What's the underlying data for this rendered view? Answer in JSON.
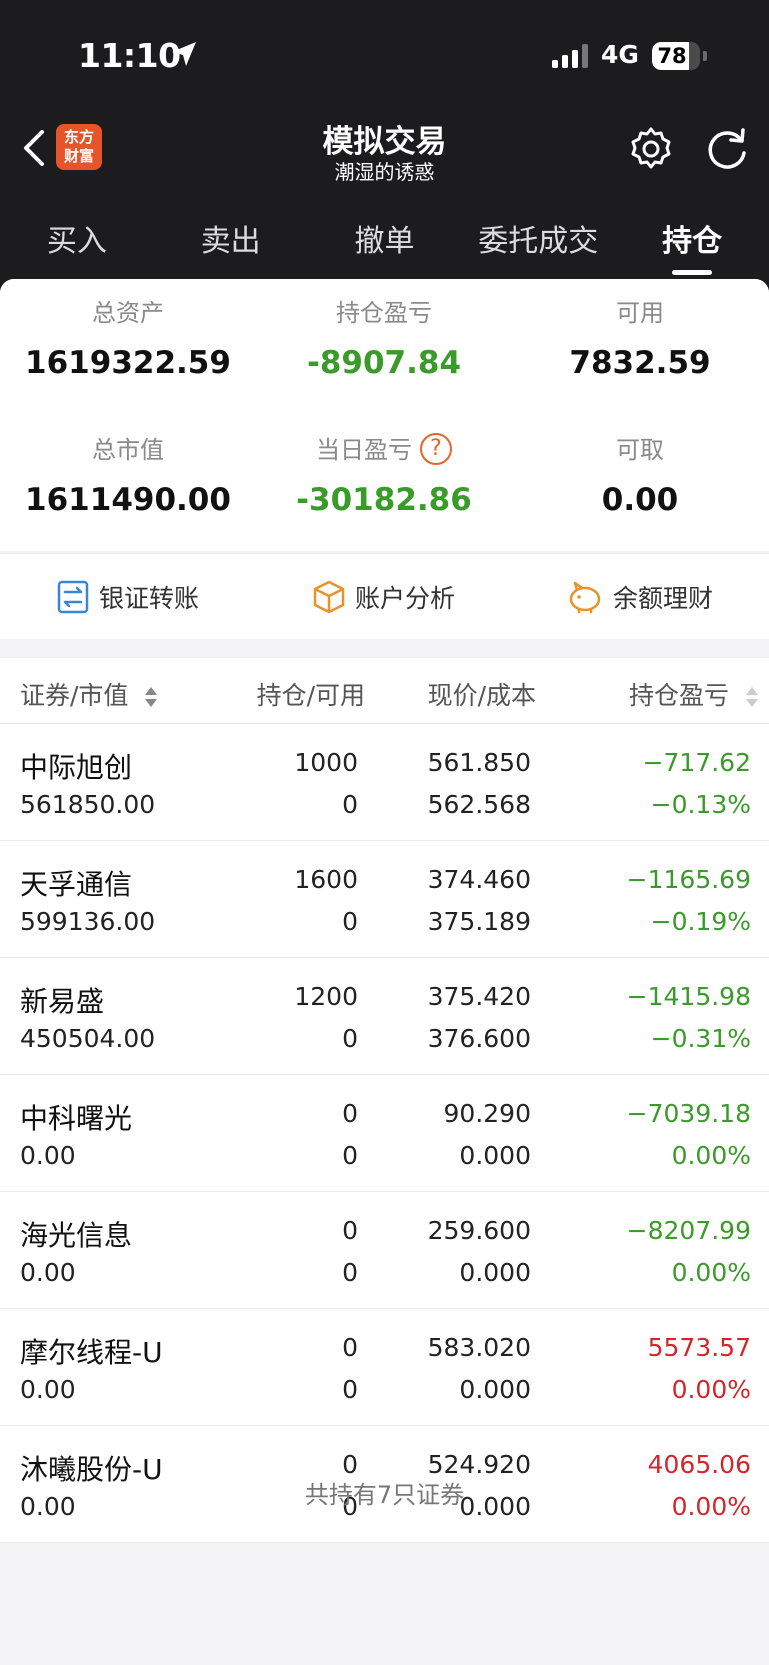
{
  "status": {
    "time": "11:10",
    "network": "4G",
    "battery": "78",
    "battery_level": 0.78
  },
  "nav": {
    "logo_line1": "东方",
    "logo_line2": "财富",
    "title": "模拟交易",
    "subtitle": "潮湿的诱惑"
  },
  "tabs": [
    {
      "label": "买入"
    },
    {
      "label": "卖出"
    },
    {
      "label": "撤单"
    },
    {
      "label": "委托成交"
    },
    {
      "label": "持仓",
      "active": true
    }
  ],
  "summary": {
    "total_assets_label": "总资产",
    "total_assets": "1619322.59",
    "position_pl_label": "持仓盈亏",
    "position_pl": "-8907.84",
    "available_label": "可用",
    "available": "7832.59",
    "market_value_label": "总市值",
    "market_value": "1611490.00",
    "daily_pl_label": "当日盈亏",
    "daily_pl": "-30182.86",
    "withdrawable_label": "可取",
    "withdrawable": "0.00"
  },
  "actions": [
    {
      "label": "银证转账",
      "icon": "transfer-icon"
    },
    {
      "label": "账户分析",
      "icon": "box-icon"
    },
    {
      "label": "余额理财",
      "icon": "piggy-bank-icon"
    }
  ],
  "table": {
    "headers": {
      "security": "证券/市值",
      "holding": "持仓/可用",
      "price": "现价/成本",
      "pl": "持仓盈亏"
    },
    "rows": [
      {
        "name": "中际旭创",
        "market_value": "561850.00",
        "qty": "1000",
        "avail": "0",
        "price": "561.850",
        "cost": "562.568",
        "pl": "−717.62",
        "pl_pct": "−0.13%",
        "color": "green"
      },
      {
        "name": "天孚通信",
        "market_value": "599136.00",
        "qty": "1600",
        "avail": "0",
        "price": "374.460",
        "cost": "375.189",
        "pl": "−1165.69",
        "pl_pct": "−0.19%",
        "color": "green"
      },
      {
        "name": "新易盛",
        "market_value": "450504.00",
        "qty": "1200",
        "avail": "0",
        "price": "375.420",
        "cost": "376.600",
        "pl": "−1415.98",
        "pl_pct": "−0.31%",
        "color": "green"
      },
      {
        "name": "中科曙光",
        "market_value": "0.00",
        "qty": "0",
        "avail": "0",
        "price": "90.290",
        "cost": "0.000",
        "pl": "−7039.18",
        "pl_pct": "0.00%",
        "color": "green"
      },
      {
        "name": "海光信息",
        "market_value": "0.00",
        "qty": "0",
        "avail": "0",
        "price": "259.600",
        "cost": "0.000",
        "pl": "−8207.99",
        "pl_pct": "0.00%",
        "color": "green"
      },
      {
        "name": "摩尔线程-U",
        "market_value": "0.00",
        "qty": "0",
        "avail": "0",
        "price": "583.020",
        "cost": "0.000",
        "pl": "5573.57",
        "pl_pct": "0.00%",
        "color": "red"
      },
      {
        "name": "沐曦股份-U",
        "market_value": "0.00",
        "qty": "0",
        "avail": "0",
        "price": "524.920",
        "cost": "0.000",
        "pl": "4065.06",
        "pl_pct": "0.00%",
        "color": "red"
      }
    ]
  },
  "footer": "共持有7只证券",
  "colors": {
    "gain": "#d3262c",
    "loss": "#3b9b2a",
    "accent": "#e8642a"
  }
}
